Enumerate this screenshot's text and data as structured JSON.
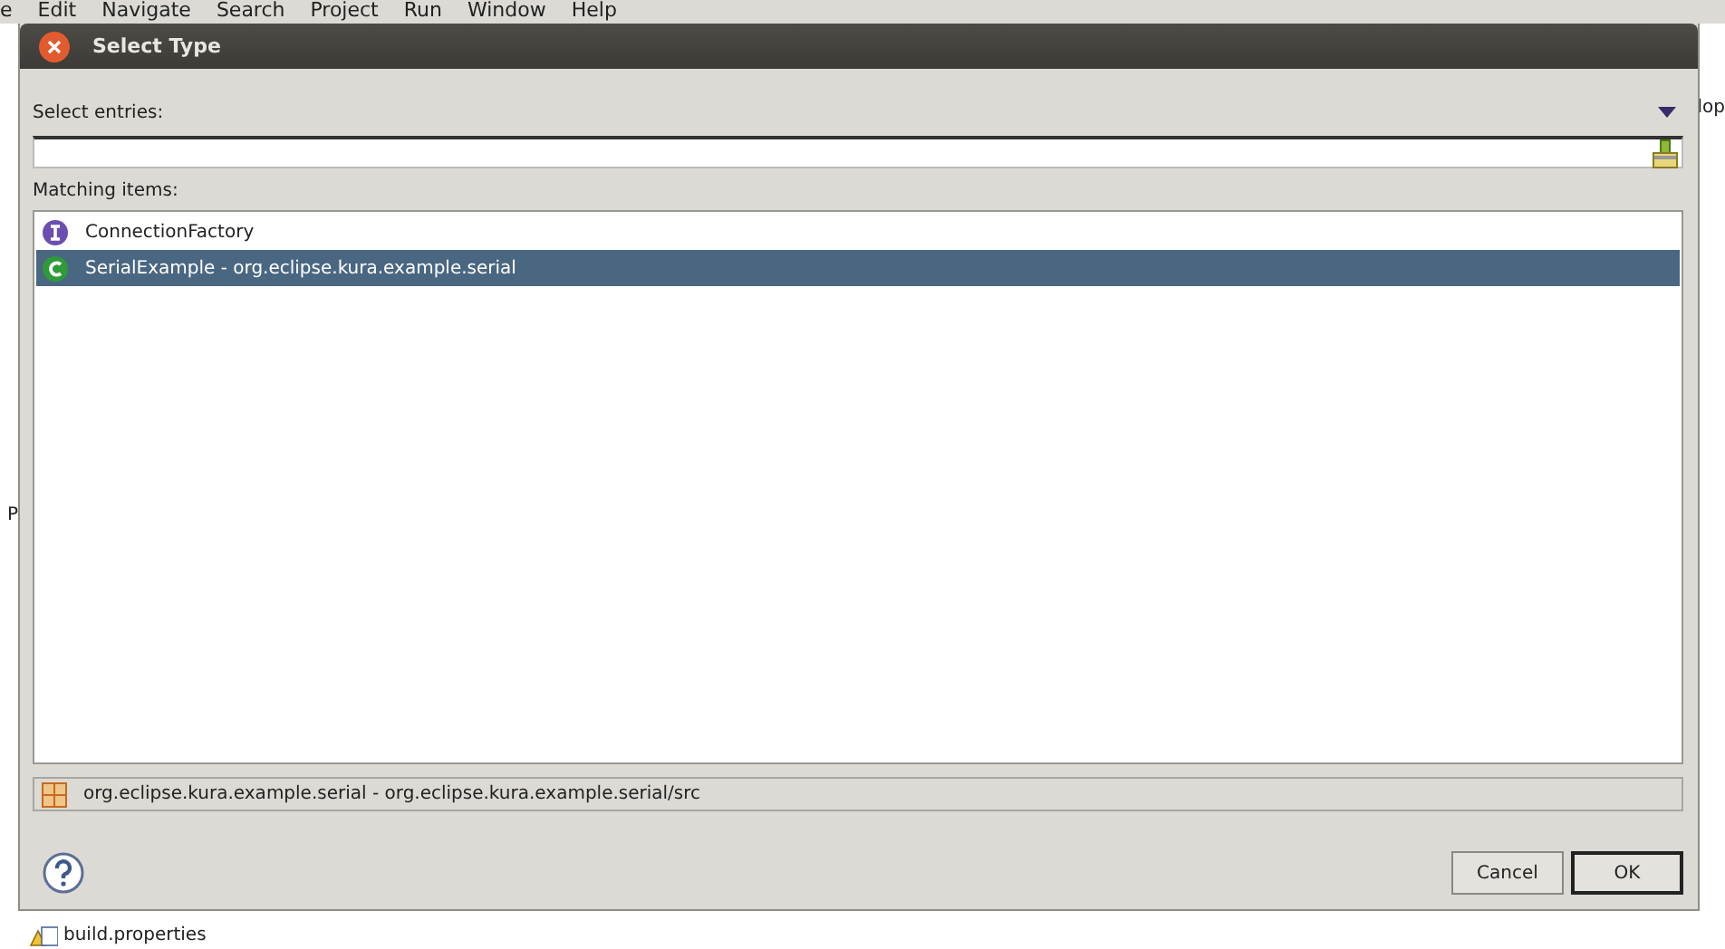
{
  "background": {
    "menu": [
      "e",
      "Edit",
      "Navigate",
      "Search",
      "Project",
      "Run",
      "Window",
      "Help"
    ],
    "left_fragment": "P",
    "right_fragment": "lop",
    "tree_item": "build.properties"
  },
  "dialog": {
    "title": "Select Type",
    "prompt": "Select entries:",
    "list_label": "Matching items:",
    "items": [
      {
        "kind": "interface",
        "label": "ConnectionFactory",
        "selected": false
      },
      {
        "kind": "class",
        "label": "SerialExample - org.eclipse.kura.example.serial",
        "selected": true
      }
    ],
    "status": "org.eclipse.kura.example.serial - org.eclipse.kura.example.serial/src",
    "buttons": [
      "Cancel",
      "OK"
    ]
  }
}
